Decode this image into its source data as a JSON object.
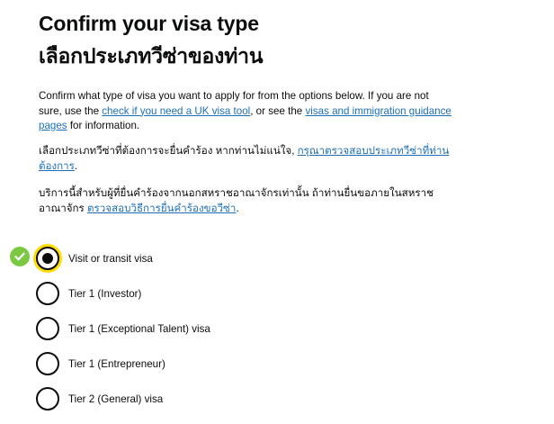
{
  "heading": {
    "en": "Confirm your visa type",
    "th": "เลือกประเภทวีซ่าของท่าน"
  },
  "intro": {
    "p1_before": "Confirm what type of visa you want to apply for from the options below. If you are not sure, use the ",
    "p1_link1": "check if you need a UK visa tool",
    "p1_middle": ", or see the ",
    "p1_link2": "visas and immigration guidance pages",
    "p1_after": " for information.",
    "p2_before": "เลือกประเภทวีซ่าที่ต้องการจะยื่นคำร้อง หากท่านไม่แน่ใจ, ",
    "p2_link": "กรุณาตรวจสอบประเภทวีซ่าที่ท่านต้องการ",
    "p2_after": ".",
    "p3_before": "บริการนี้สำหรับผู้ที่ยื่นคำร้องจากนอกสหราชอาณาจักรเท่านั้น ถ้าท่านยื่นขอภายในสหราชอาณาจักร ",
    "p3_link": "ตรวจสอบวิธีการยื่นคำร้องขอวีซ่า",
    "p3_after": "."
  },
  "options": [
    {
      "label": "Visit or transit visa",
      "checked": true
    },
    {
      "label": "Tier 1 (Investor)",
      "checked": false
    },
    {
      "label": "Tier 1 (Exceptional Talent) visa",
      "checked": false
    },
    {
      "label": "Tier 1 (Entrepreneur)",
      "checked": false
    },
    {
      "label": "Tier 2 (General) visa",
      "checked": false
    }
  ],
  "icons": {
    "selected_indicator": "check-circle-icon"
  },
  "colors": {
    "link": "#1d70b8",
    "focus": "#ffdd00",
    "success": "#7bc843",
    "text": "#0b0c0c"
  }
}
